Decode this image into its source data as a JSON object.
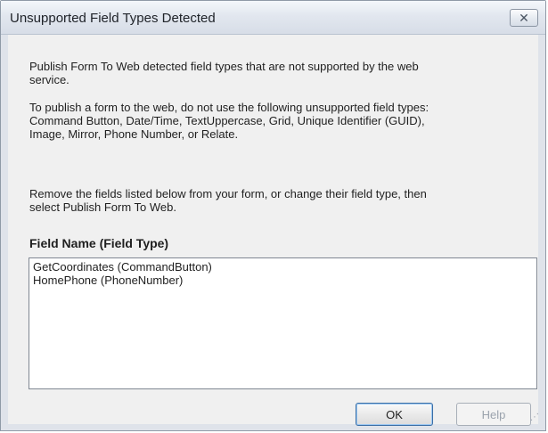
{
  "window": {
    "title": "Unsupported Field Types Detected",
    "close_icon": "close-icon"
  },
  "message": {
    "intro": "Publish Form To Web detected field types that are not supported by the web\nservice.",
    "unsupported_types": "To publish a form to the web, do not use the following unsupported field types:\nCommand Button, Date/Time, TextUppercase, Grid, Unique Identifier (GUID),\nImage, Mirror, Phone Number, or Relate.",
    "remove_instruction": "Remove the fields listed below from your form, or change their field type, then\nselect Publish Form To Web."
  },
  "field_list": {
    "header": "Field Name (Field Type)",
    "items": [
      "GetCoordinates (CommandButton)",
      "HomePhone (PhoneNumber)"
    ]
  },
  "buttons": {
    "ok": "OK",
    "help": "Help"
  },
  "colors": {
    "dialog_background": "#f0f0f0",
    "window_frame": "#dfe3ea",
    "ok_border": "#3b6ea5",
    "disabled_text": "#9ba3ad"
  },
  "icons": {
    "resize_grip": "resize-grip-icon"
  }
}
